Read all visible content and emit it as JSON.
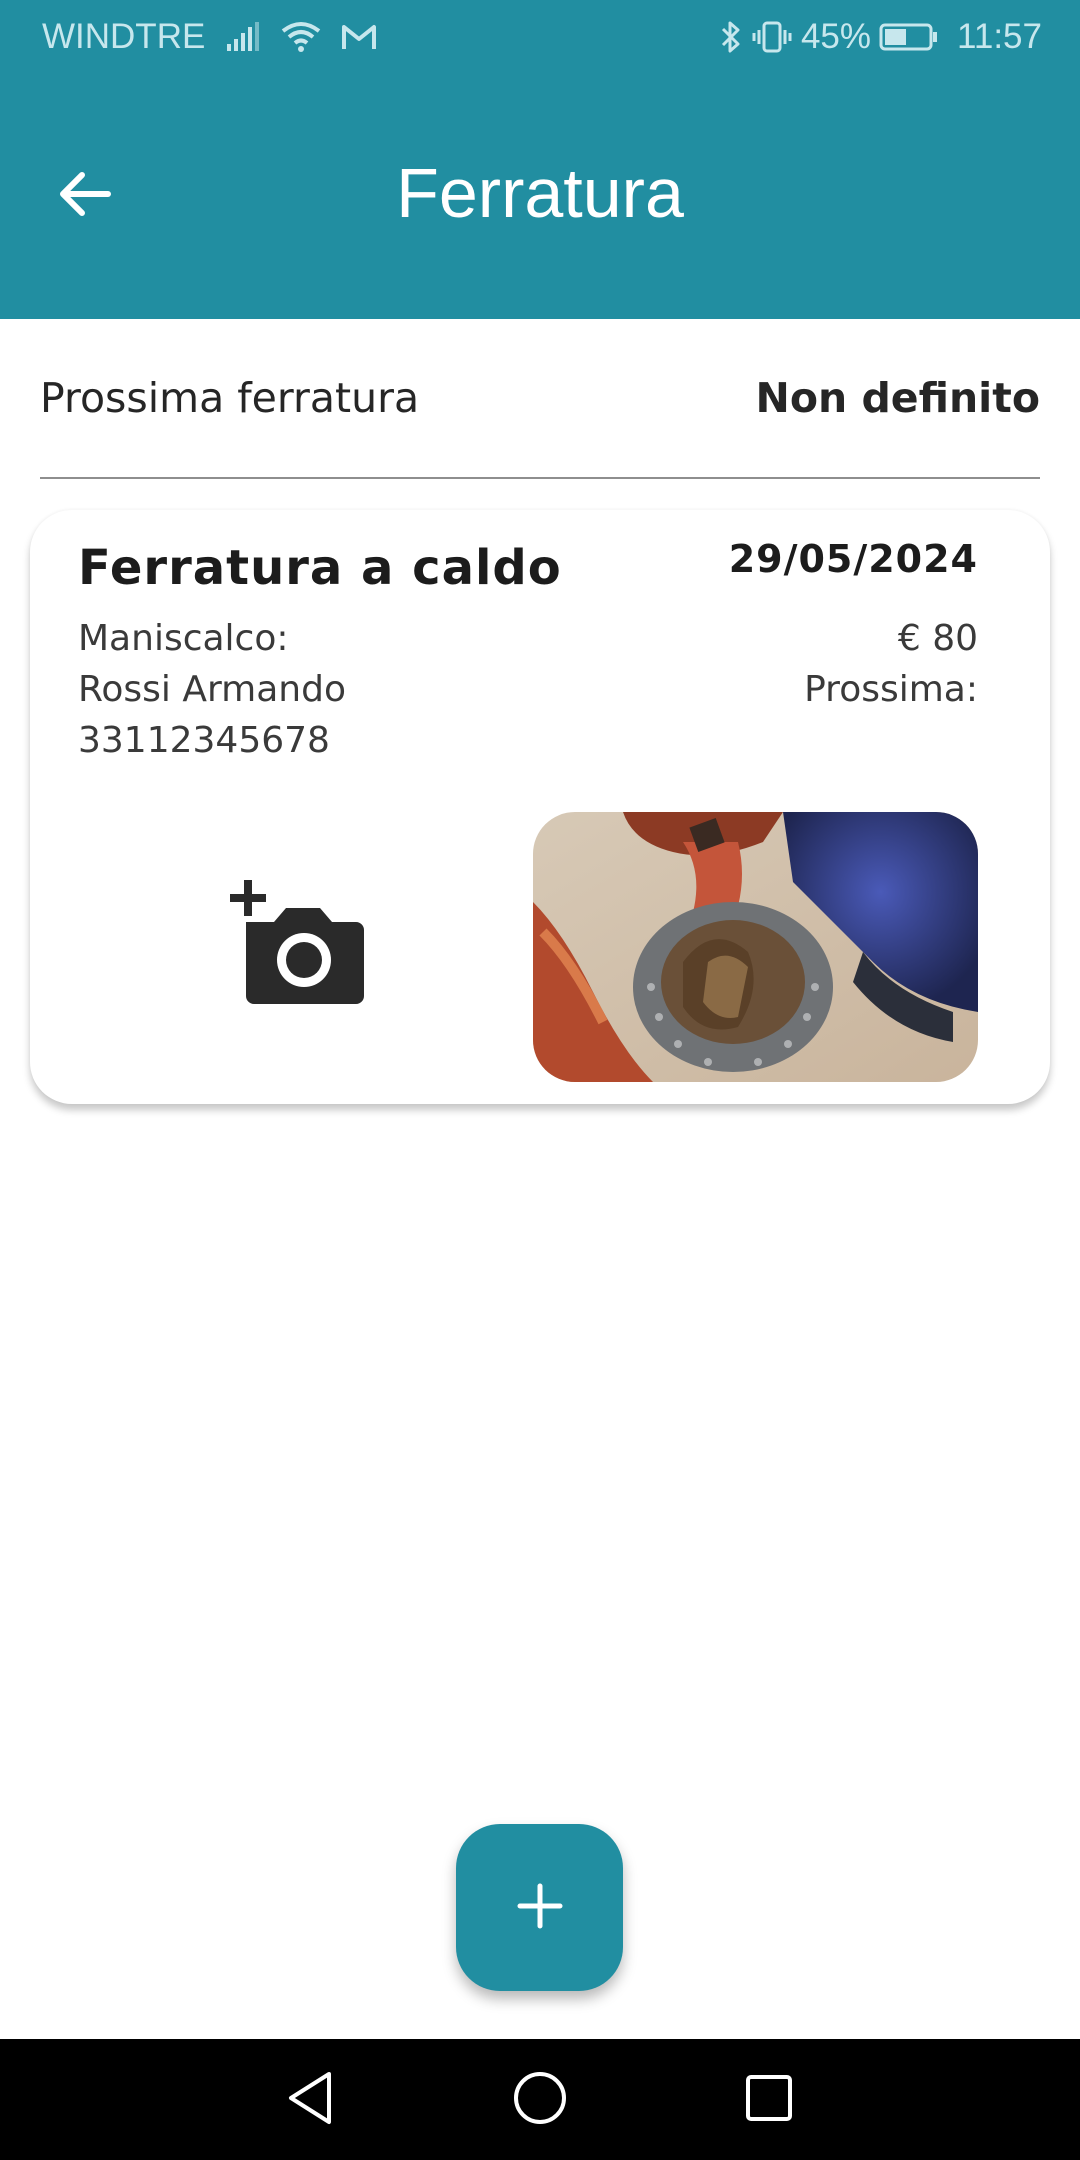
{
  "status_bar": {
    "carrier": "WINDTRE",
    "battery": "45%",
    "time": "11:57",
    "icons": [
      "signal-icon",
      "wifi-icon",
      "gmail-icon",
      "bluetooth-icon",
      "vibrate-icon",
      "battery-icon"
    ]
  },
  "header": {
    "title": "Ferratura",
    "back_icon": "arrow-left-icon",
    "background": "#218ea1"
  },
  "next_shoeing": {
    "label": "Prossima ferratura",
    "value": "Non definito"
  },
  "records": [
    {
      "title": "Ferratura a caldo",
      "date": "29/05/2024",
      "farrier_label": "Maniscalco:",
      "farrier_name": "Rossi Armando",
      "farrier_phone": "33112345678",
      "price": "€ 80",
      "next_label": "Prossima:",
      "add_photo_icon": "add-photo-camera-icon",
      "photo": "horseshoe-hoof-photo"
    }
  ],
  "fab": {
    "icon": "plus-icon"
  },
  "nav_bar": {
    "icons": [
      "back-triangle-icon",
      "home-circle-icon",
      "recents-square-icon"
    ]
  }
}
